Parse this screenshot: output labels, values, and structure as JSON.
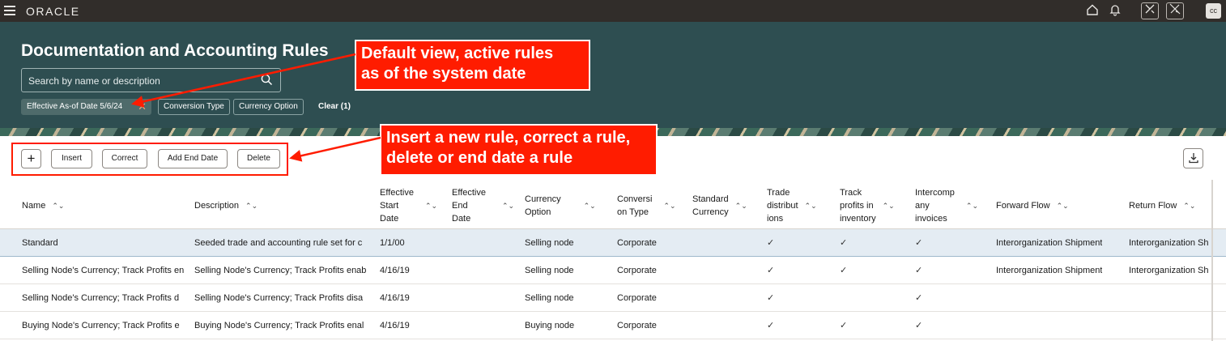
{
  "app": {
    "brand": "ORACLE",
    "avatar": "cc"
  },
  "icons": {
    "menu": "hamburger-icon",
    "home": "home-icon",
    "bell": "bell-icon",
    "tool1": "tools-icon",
    "tool2": "tools-off-icon",
    "search": "search-icon",
    "download": "download-icon"
  },
  "header": {
    "title": "Documentation and Accounting Rules",
    "search_placeholder": "Search by name or description",
    "chips": {
      "effective": "Effective As-of Date 5/6/24",
      "conversion": "Conversion Type",
      "currency": "Currency Option"
    },
    "clear": "Clear (1)"
  },
  "annotations": {
    "callout1": "Default view, active rules\nas of the system date",
    "callout2": "Insert a new rule, correct a rule,\ndelete or end date a rule"
  },
  "toolbar": {
    "plus": "+",
    "insert": "Insert",
    "correct": "Correct",
    "add_end_date": "Add End Date",
    "delete": "Delete"
  },
  "table": {
    "columns": {
      "name": "Name",
      "description": "Description",
      "start": "Effective\nStart\nDate",
      "end": "Effective\nEnd\nDate",
      "currency": "Currency\nOption",
      "conversion": "Conversi\non Type",
      "standard": "Standard\nCurrency",
      "trade": "Trade\ndistribut\nions",
      "track": "Track\nprofits in\ninventory",
      "interco": "Intercomp\nany\ninvoices",
      "forward": "Forward Flow",
      "return": "Return Flow"
    },
    "rows": [
      {
        "name": "Standard",
        "description": "Seeded trade and accounting rule set for c",
        "start": "1/1/00",
        "currency": "Selling node",
        "conversion": "Corporate",
        "trade": "✓",
        "track": "✓",
        "interco": "✓",
        "forward": "Interorganization Shipment",
        "return": "Interorganization Sh"
      },
      {
        "name": "Selling Node's Currency; Track Profits en",
        "description": "Selling Node's Currency; Track Profits enab",
        "start": "4/16/19",
        "currency": "Selling node",
        "conversion": "Corporate",
        "trade": "✓",
        "track": "✓",
        "interco": "✓",
        "forward": "Interorganization Shipment",
        "return": "Interorganization Sh"
      },
      {
        "name": "Selling Node's Currency; Track Profits d",
        "description": "Selling Node's Currency; Track Profits disa",
        "start": "4/16/19",
        "currency": "Selling node",
        "conversion": "Corporate",
        "trade": "✓",
        "track": "",
        "interco": "✓",
        "forward": "",
        "return": ""
      },
      {
        "name": "Buying Node's Currency; Track Profits e",
        "description": "Buying Node's Currency; Track Profits enal",
        "start": "4/16/19",
        "currency": "Buying node",
        "conversion": "Corporate",
        "trade": "✓",
        "track": "✓",
        "interco": "✓",
        "forward": "",
        "return": ""
      }
    ]
  }
}
